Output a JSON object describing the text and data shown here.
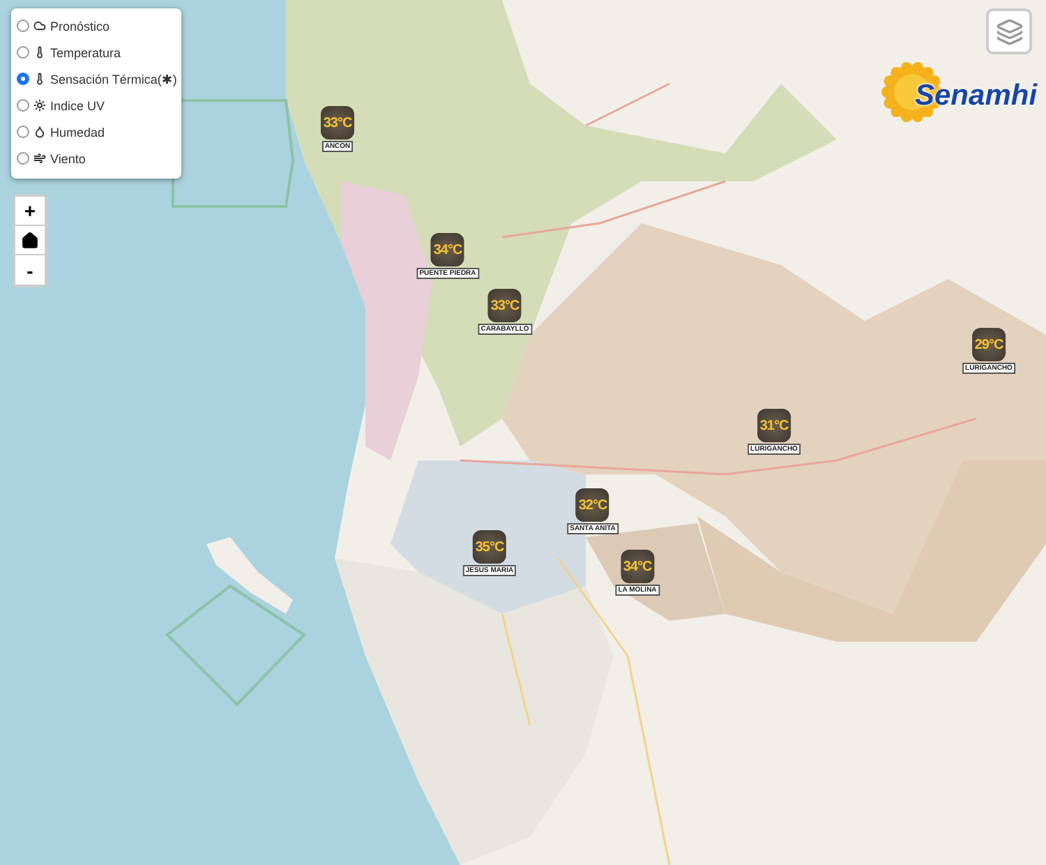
{
  "layer_selector": {
    "options": [
      {
        "label": "Pronóstico",
        "kind": "forecast",
        "selected": false
      },
      {
        "label": "Temperatura",
        "kind": "temperature",
        "selected": false
      },
      {
        "label": "Sensación Térmica(✱)",
        "kind": "temperature",
        "selected": true
      },
      {
        "label": "Indice UV",
        "kind": "uv",
        "selected": false
      },
      {
        "label": "Humedad",
        "kind": "humidity",
        "selected": false
      },
      {
        "label": "Viento",
        "kind": "wind",
        "selected": false
      }
    ]
  },
  "zoom_controls": {
    "zoom_in": "+",
    "zoom_out": "-"
  },
  "logo": {
    "name": "Senamhi"
  },
  "markers": [
    {
      "value": "33°C",
      "station": "ANCON"
    },
    {
      "value": "34°C",
      "station": "PUENTE PIEDRA"
    },
    {
      "value": "33°C",
      "station": "CARABAYLLO"
    },
    {
      "value": "29°C",
      "station": "LURIGANCHO"
    },
    {
      "value": "31°C",
      "station": "LURIGANCHO"
    },
    {
      "value": "32°C",
      "station": "SANTA ANITA"
    },
    {
      "value": "35°C",
      "station": "JESUS MARIA"
    },
    {
      "value": "34°C",
      "station": "LA MOLINA"
    }
  ]
}
